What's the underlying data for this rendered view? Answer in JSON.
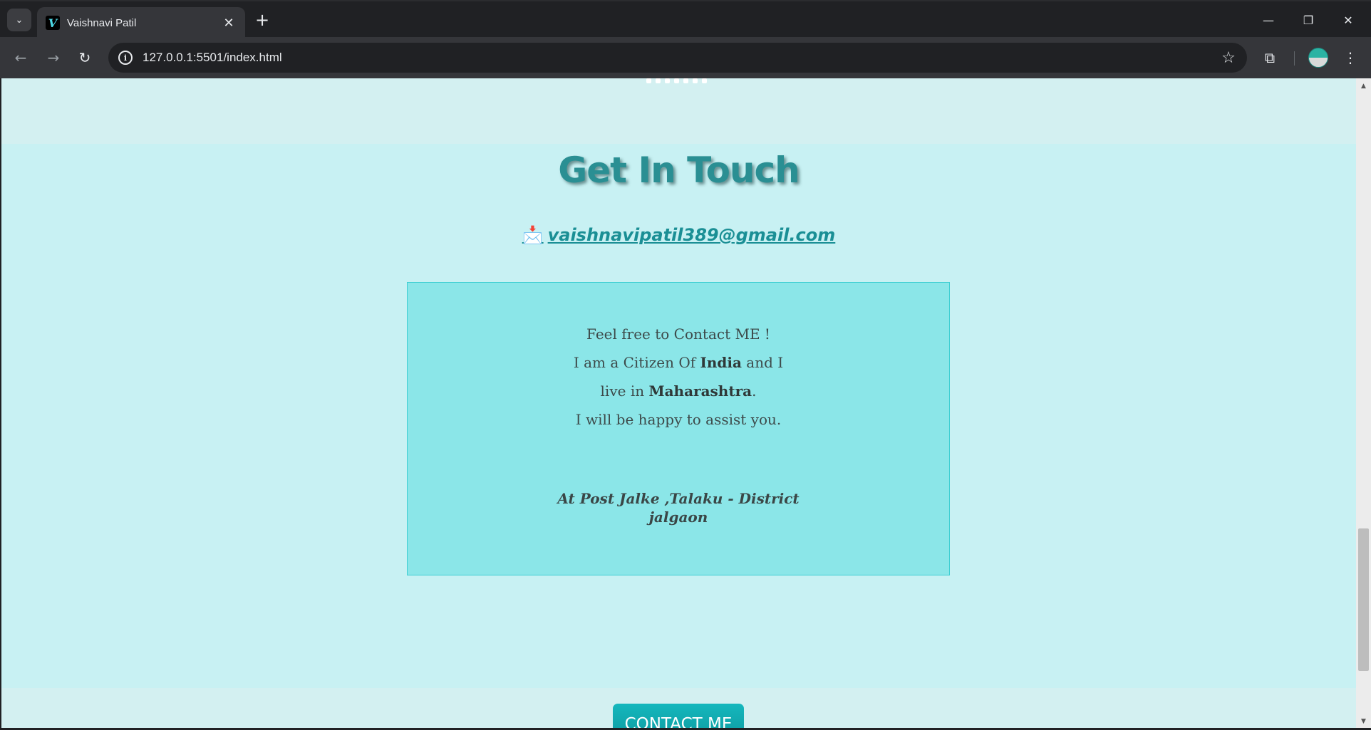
{
  "browser": {
    "tab_title": "Vaishnavi Patil",
    "favicon_letter": "V",
    "tab_close": "✕",
    "new_tab": "+",
    "tab_search": "⌄",
    "url": "127.0.0.1:5501/index.html",
    "window": {
      "minimize": "—",
      "restore": "❐",
      "close": "✕"
    },
    "icons": {
      "back": "←",
      "forward": "→",
      "reload": "↻",
      "info": "i",
      "bookmark": "☆",
      "extensions": "⧉",
      "menu": "⋮"
    }
  },
  "page": {
    "heading": "Get In Touch",
    "email_icon": "📩",
    "email": "vaishnavipatil389@gmail.com",
    "card": {
      "line1": "Feel free to Contact ME !",
      "line2_prefix": "I am a Citizen Of ",
      "line2_bold": "India",
      "line2_suffix": " and I",
      "line3_prefix": "live in ",
      "line3_bold": "Maharashtra",
      "line3_suffix": ".",
      "line4": "I will be happy to assist you.",
      "address_line1": "At Post Jalke ,Talaku - District",
      "address_line2": "jalgaon"
    },
    "contact_button": "CONTACT ME"
  },
  "scrollbar": {
    "up": "▲",
    "down": "▼"
  }
}
